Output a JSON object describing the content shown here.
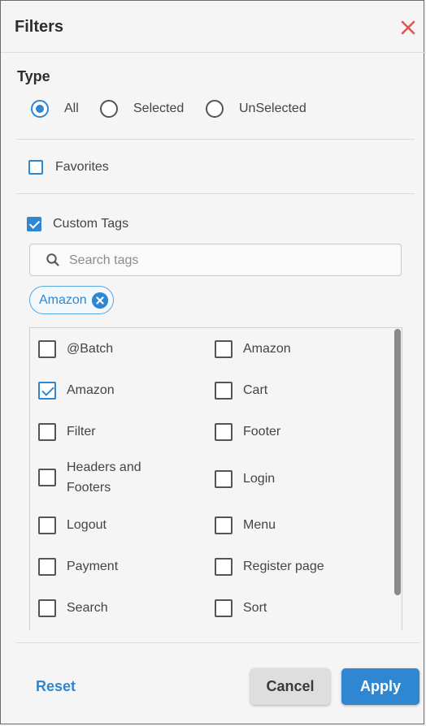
{
  "header": {
    "title": "Filters",
    "close_icon": "close-icon"
  },
  "type_section": {
    "label": "Type",
    "options": [
      {
        "label": "All",
        "selected": true
      },
      {
        "label": "Selected",
        "selected": false
      },
      {
        "label": "UnSelected",
        "selected": false
      }
    ]
  },
  "favorites": {
    "label": "Favorites",
    "checked": false
  },
  "custom_tags": {
    "label": "Custom Tags",
    "checked": true,
    "search_placeholder": "Search tags",
    "search_value": "",
    "selected_chip": "Amazon",
    "tags": [
      {
        "label": "@Batch",
        "checked": false
      },
      {
        "label": "Amazon",
        "checked": false
      },
      {
        "label": "Amazon",
        "checked": true
      },
      {
        "label": "Cart",
        "checked": false
      },
      {
        "label": "Filter",
        "checked": false
      },
      {
        "label": "Footer",
        "checked": false
      },
      {
        "label": "Headers and Footers",
        "checked": false
      },
      {
        "label": "Login",
        "checked": false
      },
      {
        "label": "Logout",
        "checked": false
      },
      {
        "label": "Menu",
        "checked": false
      },
      {
        "label": "Payment",
        "checked": false
      },
      {
        "label": "Register page",
        "checked": false
      },
      {
        "label": "Search",
        "checked": false
      },
      {
        "label": "Sort",
        "checked": false
      }
    ]
  },
  "footer": {
    "reset_label": "Reset",
    "cancel_label": "Cancel",
    "apply_label": "Apply"
  },
  "colors": {
    "accent": "#2f86d1",
    "close": "#e05555"
  }
}
